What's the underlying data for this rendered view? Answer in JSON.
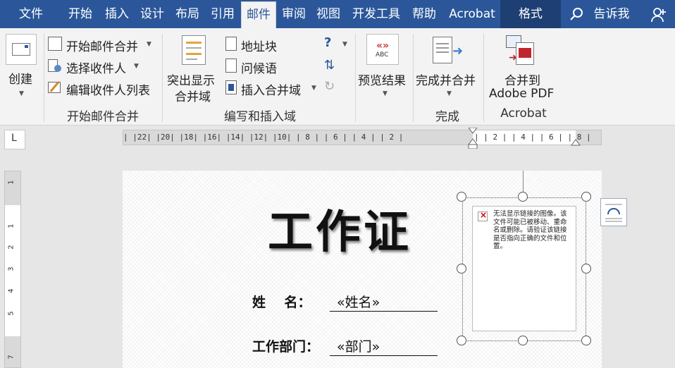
{
  "tabs": [
    {
      "label": "文件"
    },
    {
      "label": "开始"
    },
    {
      "label": "插入"
    },
    {
      "label": "设计"
    },
    {
      "label": "布局"
    },
    {
      "label": "引用"
    },
    {
      "label": "邮件"
    },
    {
      "label": "审阅"
    },
    {
      "label": "视图"
    },
    {
      "label": "开发工具"
    },
    {
      "label": "帮助"
    },
    {
      "label": "Acrobat"
    },
    {
      "label": "格式"
    }
  ],
  "search": {
    "label": "告诉我"
  },
  "ribbon": {
    "create": {
      "label": "创建"
    },
    "start_group": {
      "start_merge": "开始邮件合并",
      "select_recipients": "选择收件人",
      "edit_list": "编辑收件人列表",
      "group_label": "开始邮件合并"
    },
    "write_group": {
      "highlight_line1": "突出显示",
      "highlight_line2": "合并域",
      "address_block": "地址块",
      "greeting": "问候语",
      "insert_field": "插入合并域",
      "group_label": "编写和插入域"
    },
    "preview": {
      "label": "预览结果"
    },
    "finish": {
      "label": "完成并合并",
      "group_label": "完成"
    },
    "acrobat": {
      "line1": "合并到",
      "line2": "Adobe PDF",
      "group_label": "Acrobat"
    }
  },
  "ruler": {
    "h_left": "| |22| |20| |18| |16| |14| |12| |10| | 8 | | 6 | | 4 | | 2 |",
    "h_right": "| | 2 | | 4 | | 6 | | 8 |",
    "v_numbers": [
      "1",
      "1",
      "2",
      "3",
      "4",
      "5",
      "7"
    ]
  },
  "document": {
    "title": "工作证",
    "field1_label": "姓    名：",
    "field1_value": "«姓名»",
    "field2_label": "工作部门：",
    "field2_value": "«部门»",
    "broken_image_text": "无法显示链接的图像。该文件可能已被移动、重命名或删除。请验证该链接是否指向正确的文件和位置。"
  },
  "colors": {
    "accent": "#2b579a"
  }
}
